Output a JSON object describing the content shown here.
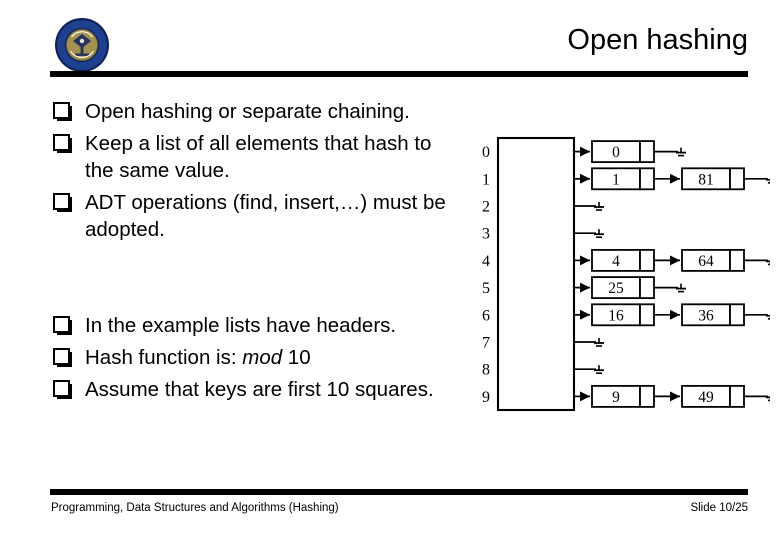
{
  "slide": {
    "title": "Open hashing",
    "logo_name": "university-seal-logo",
    "logo_colors": {
      "ring": "#1f3f8f",
      "ring_edge": "#0d2257",
      "inner": "#9c8a4e",
      "emblem": "#1b2a4a",
      "ring_text": "#ffffff"
    },
    "rule_color": "#000000"
  },
  "bullets": {
    "group_a": [
      {
        "text": "Open hashing or separate chaining."
      },
      {
        "text": "Keep a list of all elements that hash to the same value."
      },
      {
        "text": "ADT operations (find, insert,…) must be adopted."
      }
    ],
    "group_b": [
      {
        "text": "In the example lists have headers."
      },
      {
        "text": "Hash function is: ",
        "emphasis": "mod",
        "text_after": " 10"
      },
      {
        "text": "Assume that keys are first 10 squares."
      }
    ],
    "bullet_glyph": "open-square-shadow"
  },
  "figure": {
    "name": "open-hashing-chaining-diagram",
    "caption": "",
    "index_labels": [
      "0",
      "1",
      "2",
      "3",
      "4",
      "5",
      "6",
      "7",
      "8",
      "9"
    ],
    "buckets": [
      {
        "index": "0",
        "chain": [
          "0"
        ]
      },
      {
        "index": "1",
        "chain": [
          "1",
          "81"
        ]
      },
      {
        "index": "2",
        "chain": []
      },
      {
        "index": "3",
        "chain": []
      },
      {
        "index": "4",
        "chain": [
          "4",
          "64"
        ]
      },
      {
        "index": "5",
        "chain": [
          "25"
        ]
      },
      {
        "index": "6",
        "chain": [
          "16",
          "36"
        ]
      },
      {
        "index": "7",
        "chain": []
      },
      {
        "index": "8",
        "chain": []
      },
      {
        "index": "9",
        "chain": [
          "9",
          "49"
        ]
      }
    ]
  },
  "footer": {
    "left": "Programming, Data Structures and Algorithms  (Hashing)",
    "right": "Slide 10/25"
  }
}
